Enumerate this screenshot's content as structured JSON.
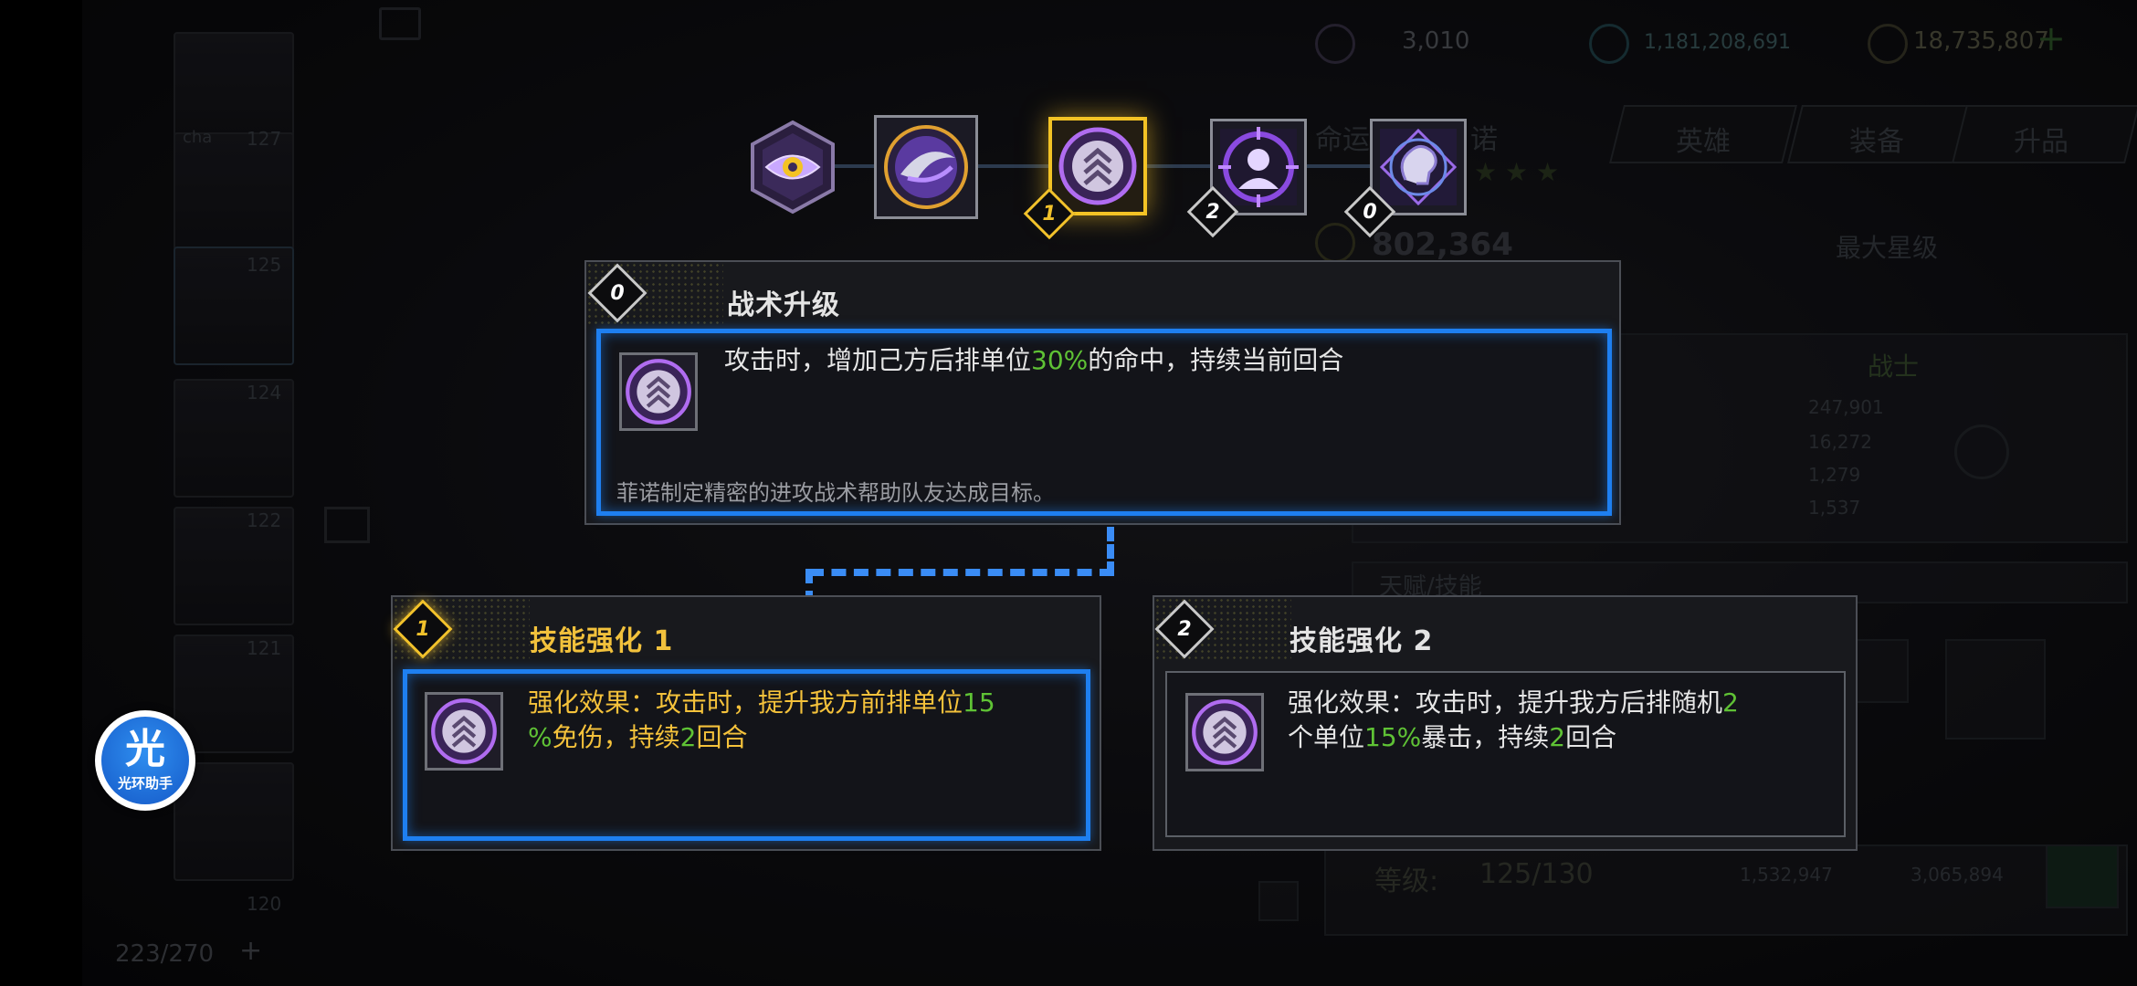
{
  "background": {
    "currency_1": "3,010",
    "currency_2": "1,181,208,691",
    "currency_3": "18,735,807",
    "hero_name_partial": "命运",
    "hero_name_partial_2": "诺",
    "tabs": [
      "英雄",
      "装备",
      "升品"
    ],
    "power": "802,364",
    "max_star": "最大星级",
    "class_label": "战士",
    "stats": [
      "247,901",
      "16,272",
      "1,279",
      "1,537"
    ],
    "talent_label": "天赋/技能",
    "level_label": "等级:",
    "level_value": "125/130",
    "upgrade_cost_1": "1,532,947",
    "upgrade_cost_2": "3,065,894",
    "roster_count": "223/270",
    "roster_levels": [
      "127",
      "125",
      "124",
      "122",
      "121",
      "120"
    ],
    "roster_name_partial": "cha"
  },
  "skill_nodes": [
    {
      "icon": "eye-hex-icon",
      "badge": ""
    },
    {
      "icon": "crescent-blade-icon",
      "badge": ""
    },
    {
      "icon": "chevron-up-icon",
      "badge": "1"
    },
    {
      "icon": "target-person-icon",
      "badge": "2"
    },
    {
      "icon": "brain-icon",
      "badge": "0"
    }
  ],
  "tactic_panel": {
    "badge": "0",
    "title": "战术升级",
    "desc_before": "攻击时，增加己方后排单位",
    "desc_highlight": "30%",
    "desc_after": "的命中，持续当前回合",
    "flavor": "菲诺制定精密的进攻战术帮助队友达成目标。"
  },
  "enhance_1": {
    "badge": "1",
    "title": "技能强化 1",
    "line1_before": "强化效果：攻击时，提升我方前排单位",
    "line1_highlight": "15",
    "line2_highlight": "%",
    "line2_mid": "免伤，持续",
    "line2_highlight2": "2",
    "line2_after": "回合"
  },
  "enhance_2": {
    "badge": "2",
    "title": "技能强化 2",
    "line1_before": "强化效果：攻击时，提升我方后排随机",
    "line1_highlight": "2",
    "line2_before": "个单位",
    "line2_highlight": "15%",
    "line2_mid": "暴击，持续",
    "line2_highlight2": "2",
    "line2_after": "回合"
  },
  "helper": {
    "glyph": "光",
    "label": "光环助手"
  },
  "colors": {
    "gold": "#f2c13c",
    "green": "#5fc235",
    "blue_frame": "#1e7ff0"
  }
}
